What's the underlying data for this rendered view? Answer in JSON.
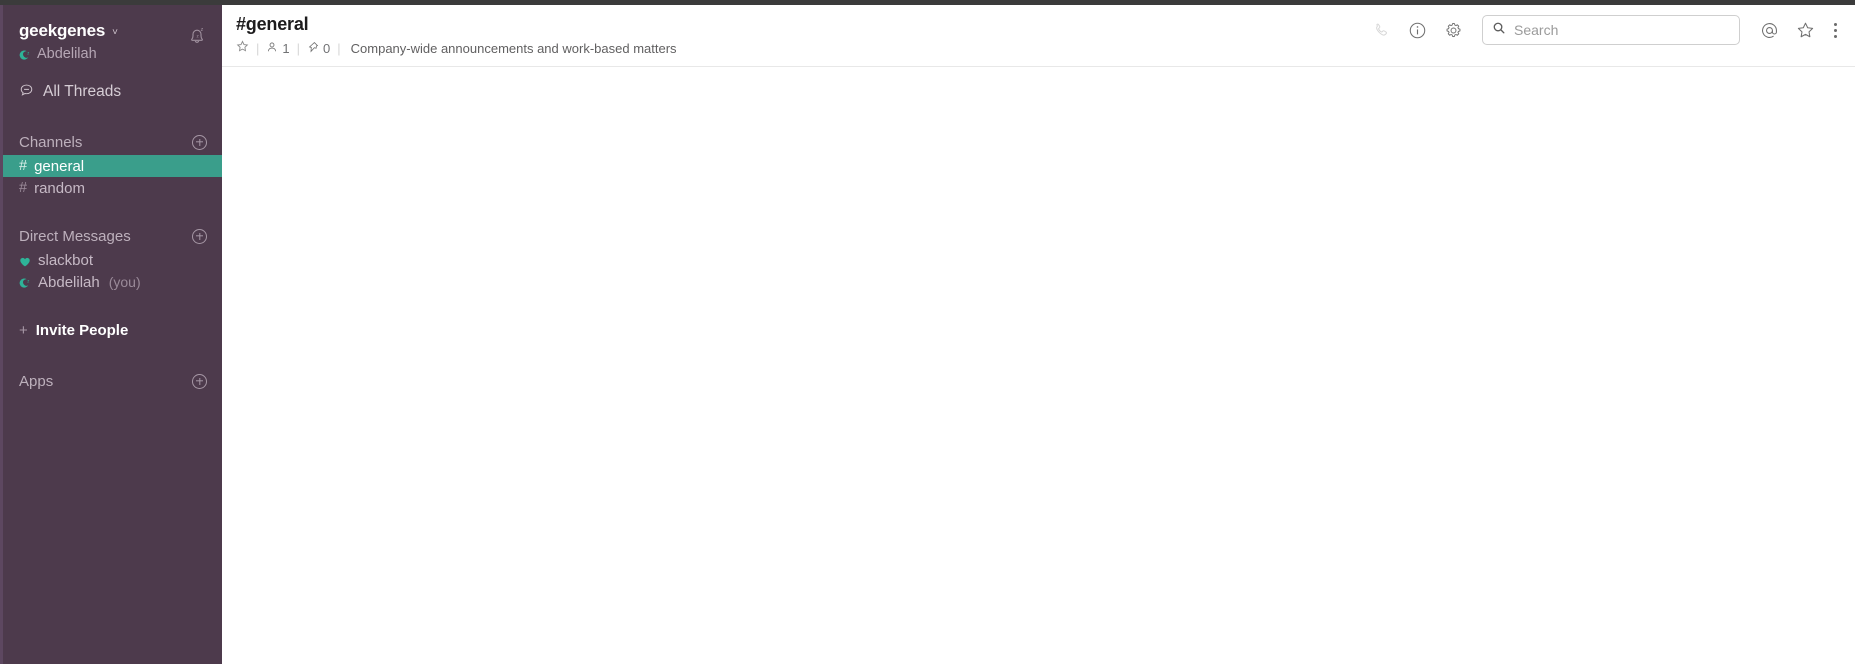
{
  "workspace": {
    "name": "geekgenes",
    "chevron": "˅",
    "user": "Abdelilah",
    "notifications_icon": "bell-snooze-icon"
  },
  "sidebar": {
    "all_threads": {
      "label": "All Threads",
      "icon": "threads-icon"
    },
    "channels_section": {
      "title": "Channels",
      "add_icon": "plus-circle-icon",
      "items": [
        {
          "prefix": "#",
          "label": "general",
          "active": true
        },
        {
          "prefix": "#",
          "label": "random",
          "active": false
        }
      ]
    },
    "dm_section": {
      "title": "Direct Messages",
      "add_icon": "plus-circle-icon",
      "items": [
        {
          "label": "slackbot",
          "status": "heart",
          "suffix": ""
        },
        {
          "label": "Abdelilah",
          "status": "away",
          "suffix": "(you)"
        }
      ]
    },
    "invite": {
      "plus": "+",
      "label": "Invite People"
    },
    "apps_section": {
      "title": "Apps",
      "add_icon": "plus-circle-icon"
    }
  },
  "channel": {
    "title": "#general",
    "star_icon": "star-outline-icon",
    "member_icon": "person-icon",
    "member_count": "1",
    "pin_icon": "pin-icon",
    "pin_count": "0",
    "separator": "|",
    "topic": "Company-wide announcements and work-based matters"
  },
  "toolbar": {
    "call_icon": "phone-icon",
    "info_icon": "info-circle-icon",
    "settings_icon": "gear-icon",
    "mentions_icon": "at-mention-icon",
    "starred_icon": "star-icon",
    "more_icon": "kebab-menu-icon"
  },
  "search": {
    "placeholder": "Search",
    "value": "",
    "icon": "search-icon"
  },
  "colors": {
    "sidebar_bg": "#4d3a4c",
    "sidebar_edge": "#5d4760",
    "active_channel": "#3a9e8b",
    "top_strip": "#3b3b3b",
    "status_teal": "#2eb398",
    "text_primary": "#1d1c1d",
    "text_muted": "#717274"
  }
}
